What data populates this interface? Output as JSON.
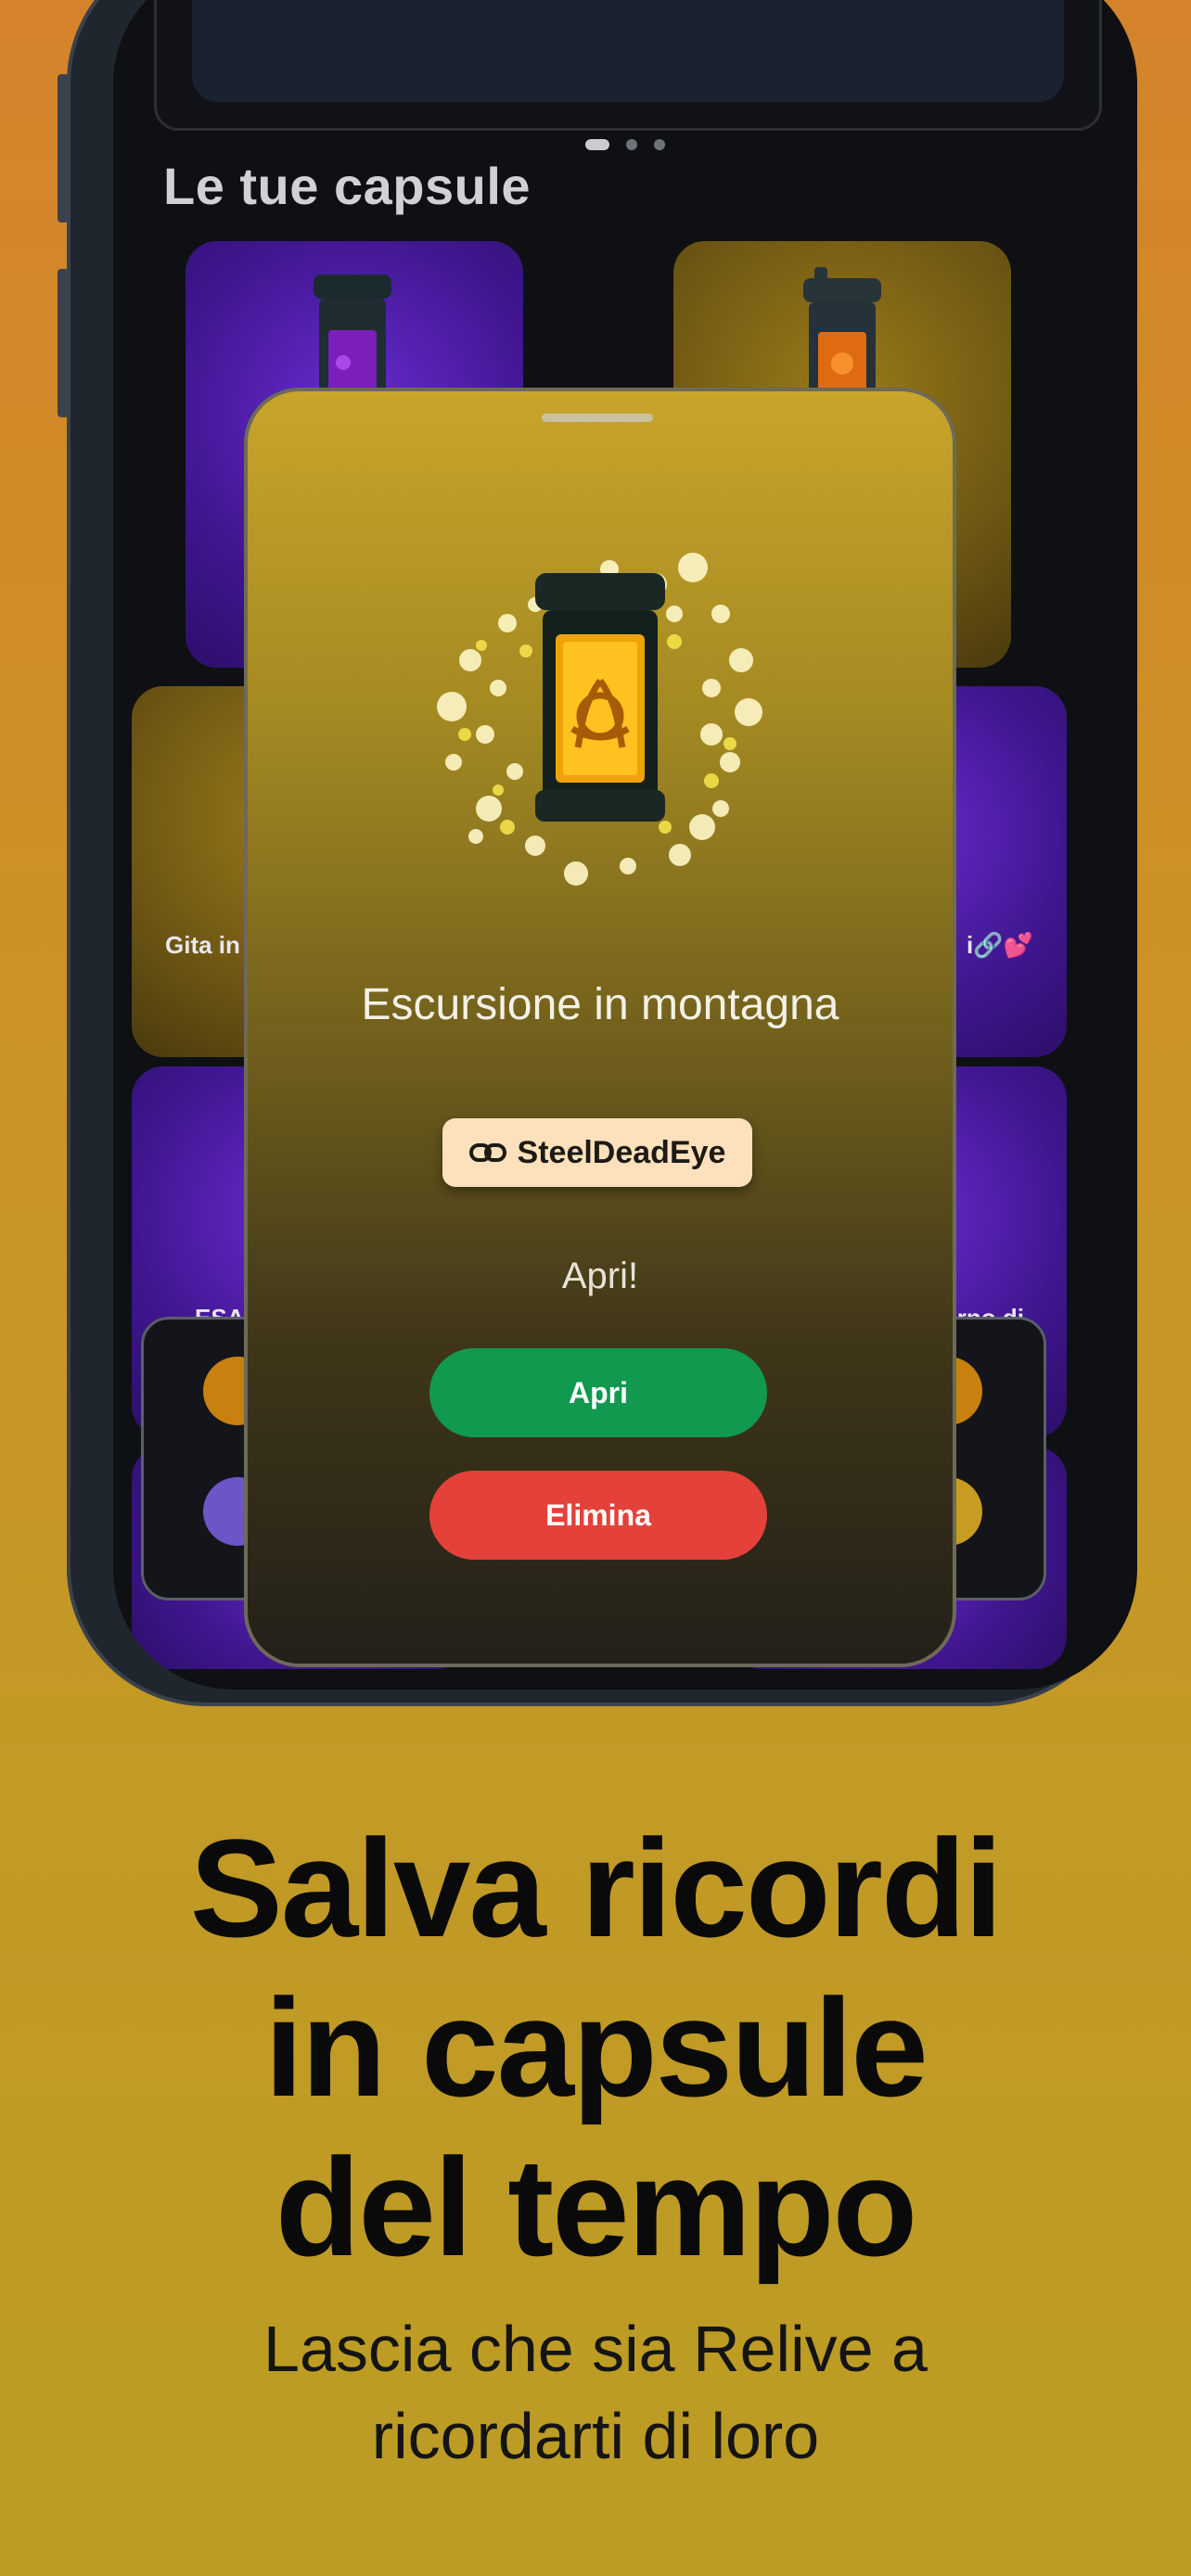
{
  "app": {
    "top_card_text": "",
    "section_title": "Le tue capsule",
    "carousel": {
      "pages": 3,
      "active": 0
    },
    "tiles": [
      {
        "label": ""
      },
      {
        "label": ""
      },
      {
        "label": "Gita in"
      },
      {
        "label": "i🔗💕"
      },
      {
        "label": "ESA"
      },
      {
        "label": "rno di"
      }
    ]
  },
  "sheet": {
    "capsule_title": "Escursione in montagna",
    "owner_chip": {
      "icon": "link-icon",
      "text": "SteelDeadEye"
    },
    "prompt": "Apri!",
    "open_button": "Apri",
    "delete_button": "Elimina"
  },
  "marketing": {
    "headline_lines": [
      "Salva ricordi",
      "in capsule",
      "del tempo"
    ],
    "subline_lines": [
      "Lascia che sia Relive a",
      "ricordarti di loro"
    ]
  },
  "colors": {
    "background_top": "#d5832a",
    "background_bottom": "#bb9c23",
    "open_button": "#10994f",
    "delete_button": "#e4413a",
    "chip": "#fde1bd",
    "tile_purple": "#4a1aa8",
    "tile_gold": "#7a6014"
  }
}
